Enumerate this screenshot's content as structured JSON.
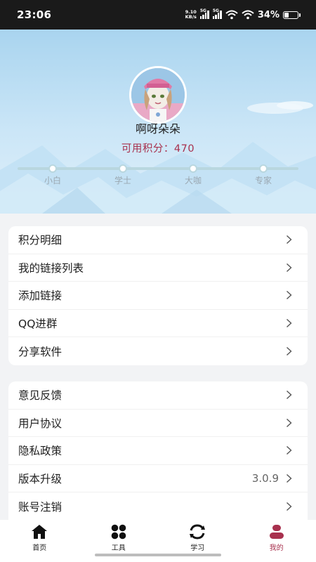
{
  "status_bar": {
    "time": "23:06",
    "net_speed_value": "9.10",
    "net_speed_unit": "KB/s",
    "sig1_label": "5G",
    "sig2_label": "5G",
    "battery": "34%"
  },
  "profile": {
    "nickname": "啊呀朵朵",
    "points_label": "可用积分：",
    "points_value": "470",
    "levels": [
      "小白",
      "学士",
      "大咖",
      "专家"
    ]
  },
  "menu_group_1": [
    {
      "label": "积分明细"
    },
    {
      "label": "我的链接列表"
    },
    {
      "label": "添加链接"
    },
    {
      "label": "QQ进群"
    },
    {
      "label": "分享软件"
    }
  ],
  "menu_group_2": [
    {
      "label": "意见反馈"
    },
    {
      "label": "用户协议"
    },
    {
      "label": "隐私政策"
    },
    {
      "label": "版本升级",
      "value": "3.0.9"
    },
    {
      "label": "账号注销"
    }
  ],
  "bottom_nav": [
    {
      "label": "首页",
      "icon": "home-icon"
    },
    {
      "label": "工具",
      "icon": "grid-icon"
    },
    {
      "label": "学习",
      "icon": "refresh-icon"
    },
    {
      "label": "我的",
      "icon": "user-icon",
      "active": true
    }
  ],
  "colors": {
    "accent": "#a8314e",
    "header_sky": "#a9d4ef",
    "track": "#b9d7df"
  }
}
